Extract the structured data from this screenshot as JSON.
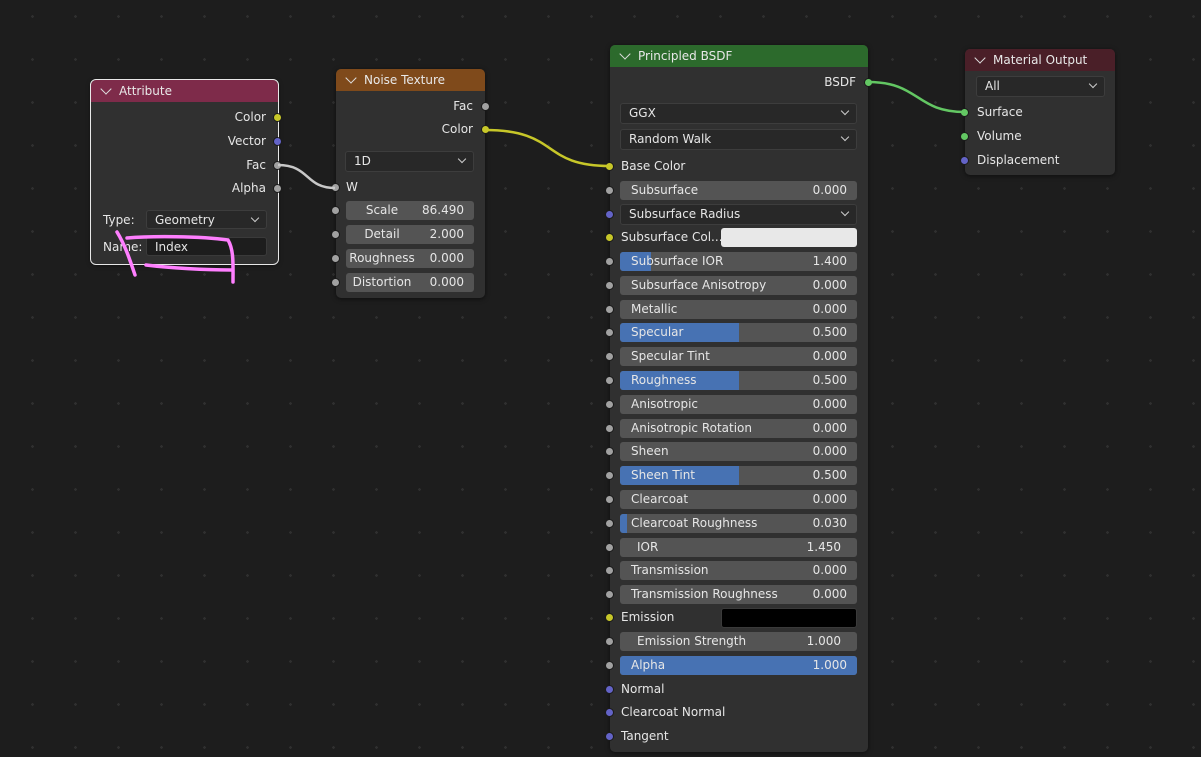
{
  "colors": {
    "canvas_bg": "#1d1d1d",
    "node_body": "#303030",
    "field_bg": "#545454",
    "slider_fill": "#4772b3",
    "socket_float": "#a1a1a1",
    "socket_color": "#c7c729",
    "socket_vector": "#6363c7",
    "socket_shader": "#63c763",
    "annotation": "#ff7fff"
  },
  "nodes": {
    "attribute": {
      "title": "Attribute",
      "header_color": "#7e2b4a",
      "outputs": [
        "Color",
        "Vector",
        "Fac",
        "Alpha"
      ],
      "type_label": "Type:",
      "type_value": "Geometry",
      "name_label": "Name:",
      "name_value": "Index"
    },
    "noise": {
      "title": "Noise Texture",
      "header_color": "#7f4a1b",
      "outputs": [
        "Fac",
        "Color"
      ],
      "dimensions": "1D",
      "w_label": "W",
      "fields": [
        {
          "label": "Scale",
          "value": "86.490"
        },
        {
          "label": "Detail",
          "value": "2.000"
        },
        {
          "label": "Roughness",
          "value": "0.000"
        },
        {
          "label": "Distortion",
          "value": "0.000"
        }
      ]
    },
    "bsdf": {
      "title": "Principled BSDF",
      "header_color": "#2c6a2c",
      "output": "BSDF",
      "distribution": "GGX",
      "subsurface_method": "Random Walk",
      "base_color_label": "Base Color",
      "subsurface": {
        "label": "Subsurface",
        "value": "0.000"
      },
      "subsurface_radius": "Subsurface Radius",
      "subsurface_color_label": "Subsurface Col...",
      "subsurface_color": "#e8e8e8",
      "sliders": [
        {
          "label": "Subsurface IOR",
          "value": "1.400",
          "fill": 0.13
        },
        {
          "label": "Subsurface Anisotropy",
          "value": "0.000",
          "fill": 0
        },
        {
          "label": "Metallic",
          "value": "0.000",
          "fill": 0
        },
        {
          "label": "Specular",
          "value": "0.500",
          "fill": 0.5
        },
        {
          "label": "Specular Tint",
          "value": "0.000",
          "fill": 0
        },
        {
          "label": "Roughness",
          "value": "0.500",
          "fill": 0.5
        },
        {
          "label": "Anisotropic",
          "value": "0.000",
          "fill": 0
        },
        {
          "label": "Anisotropic Rotation",
          "value": "0.000",
          "fill": 0
        },
        {
          "label": "Sheen",
          "value": "0.000",
          "fill": 0
        },
        {
          "label": "Sheen Tint",
          "value": "0.500",
          "fill": 0.5
        },
        {
          "label": "Clearcoat",
          "value": "0.000",
          "fill": 0
        },
        {
          "label": "Clearcoat Roughness",
          "value": "0.030",
          "fill": 0.03
        },
        {
          "label": "IOR",
          "value": "1.450",
          "fill": 0,
          "plain": true
        },
        {
          "label": "Transmission",
          "value": "0.000",
          "fill": 0
        },
        {
          "label": "Transmission Roughness",
          "value": "0.000",
          "fill": 0
        }
      ],
      "emission_label": "Emission",
      "emission_color": "#000000",
      "emission_strength": {
        "label": "Emission Strength",
        "value": "1.000"
      },
      "alpha": {
        "label": "Alpha",
        "value": "1.000",
        "fill": 1
      },
      "vector_inputs": [
        "Normal",
        "Clearcoat Normal",
        "Tangent"
      ]
    },
    "output": {
      "title": "Material Output",
      "header_color": "#4a1f28",
      "target": "All",
      "inputs": [
        "Surface",
        "Volume",
        "Displacement"
      ]
    }
  }
}
